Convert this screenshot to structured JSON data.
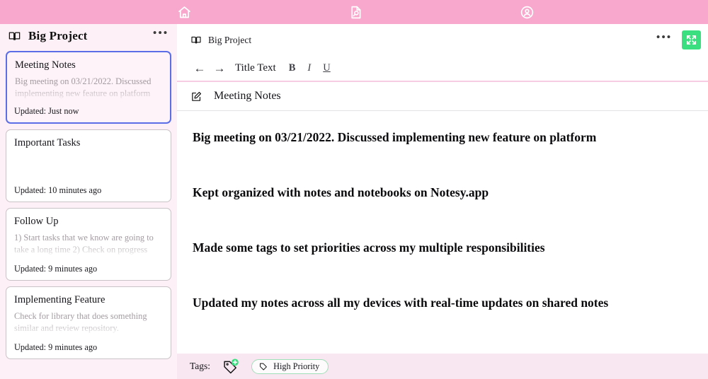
{
  "topbar": {
    "background": "#f9a8cd",
    "icons": [
      {
        "name": "home-icon",
        "label": "Home"
      },
      {
        "name": "search-document-icon",
        "label": "Search Notes"
      },
      {
        "name": "account-icon",
        "label": "Account"
      }
    ]
  },
  "sidebar": {
    "background": "#fdf0f6",
    "notebook_icon": "book-icon",
    "title": "Big Project",
    "menu_label": "•••",
    "notes": [
      {
        "title": "Meeting Notes",
        "preview": "Big meeting on 03/21/2022. Discussed implementing new feature on platform",
        "updated": "Updated: Just now",
        "selected": true
      },
      {
        "title": "Important Tasks",
        "preview": "",
        "updated": "Updated: 10 minutes ago",
        "selected": false
      },
      {
        "title": "Follow Up",
        "preview": "1) Start tasks that we know are going to take a long time 2) Check on progress",
        "updated": "Updated: 9 minutes ago",
        "selected": false
      },
      {
        "title": "Implementing Feature",
        "preview": "Check for library that does something similar and review repository.",
        "updated": "Updated: 9 minutes ago",
        "selected": false
      }
    ]
  },
  "editor": {
    "breadcrumb": {
      "icon": "book-icon",
      "text": "Big Project",
      "menu_label": "•••",
      "expand_button": {
        "name": "fullscreen-button",
        "color": "#3ae07f"
      }
    },
    "format_bar": {
      "back_arrow": "←",
      "forward_arrow": "→",
      "style_select": "Title Text",
      "bold": "B",
      "italic": "I",
      "underline": "U"
    },
    "note_title": {
      "icon": "edit-note-icon",
      "text": "Meeting Notes"
    },
    "body_lines": [
      "Big meeting on 03/21/2022.  Discussed implementing new feature on platform",
      "Kept organized with notes and notebooks on Notesy.app",
      "Made some tags to set priorities across my multiple responsibilities",
      "Updated my notes across all my devices with real-time updates on shared notes"
    ],
    "tags_bar": {
      "label": "Tags:",
      "add_tag_icon": "tag-plus-icon",
      "accent": "#3ae07f",
      "tags": [
        {
          "icon": "tag-icon",
          "label": "High Priority"
        }
      ]
    }
  }
}
